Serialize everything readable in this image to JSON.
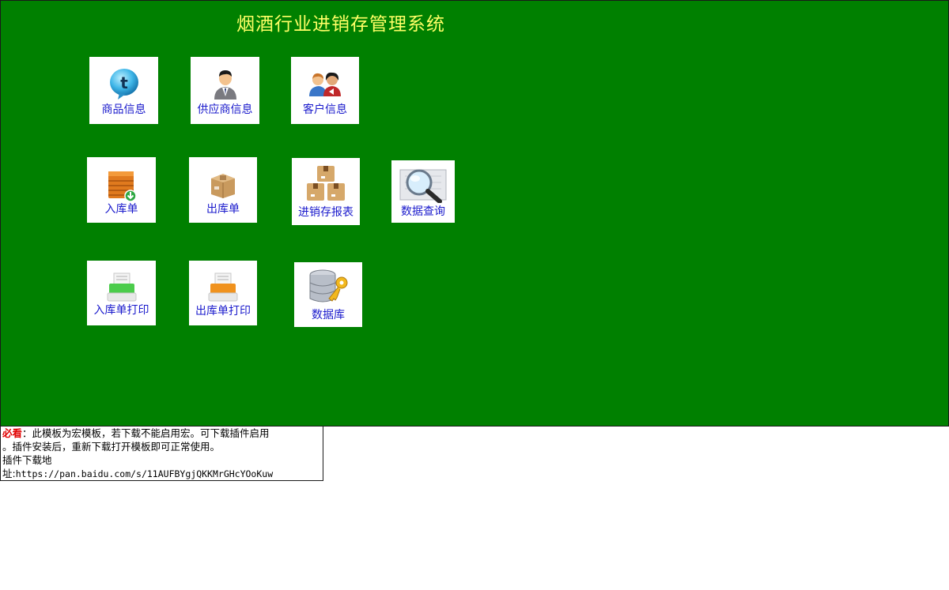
{
  "app": {
    "title": "烟酒行业进销存管理系统"
  },
  "tiles": {
    "product": {
      "label": "商品信息",
      "icon": "tweet-bubble-icon"
    },
    "supplier": {
      "label": "供应商信息",
      "icon": "businessman-icon"
    },
    "customer": {
      "label": "客户信息",
      "icon": "people-icon"
    },
    "stock_in": {
      "label": "入库单",
      "icon": "crate-download-icon"
    },
    "stock_out": {
      "label": "出库单",
      "icon": "cardboard-box-icon"
    },
    "report": {
      "label": "进销存报表",
      "icon": "stacked-boxes-icon"
    },
    "query": {
      "label": "数据查询",
      "icon": "magnifier-icon"
    },
    "print_in": {
      "label": "入库单打印",
      "icon": "green-printer-icon"
    },
    "print_out": {
      "label": "出库单打印",
      "icon": "orange-printer-icon"
    },
    "database": {
      "label": "数据库",
      "icon": "database-key-icon"
    }
  },
  "notice": {
    "must_read": "必看",
    "colon": "：",
    "line1": "此模板为宏模板，若下载不能启用宏。可下载插件启用",
    "line2": "。插件安装后，重新下载打开模板即可正常使用。",
    "line3": "插件下载地",
    "line4_prefix": "址:",
    "url": "https://pan.baidu.com/s/11AUFBYgjQKKMrGHcYOoKuw"
  },
  "colors": {
    "background": "#008000",
    "title": "#ffff66",
    "tile_label": "#1a1acc",
    "must_read": "#e00000"
  }
}
